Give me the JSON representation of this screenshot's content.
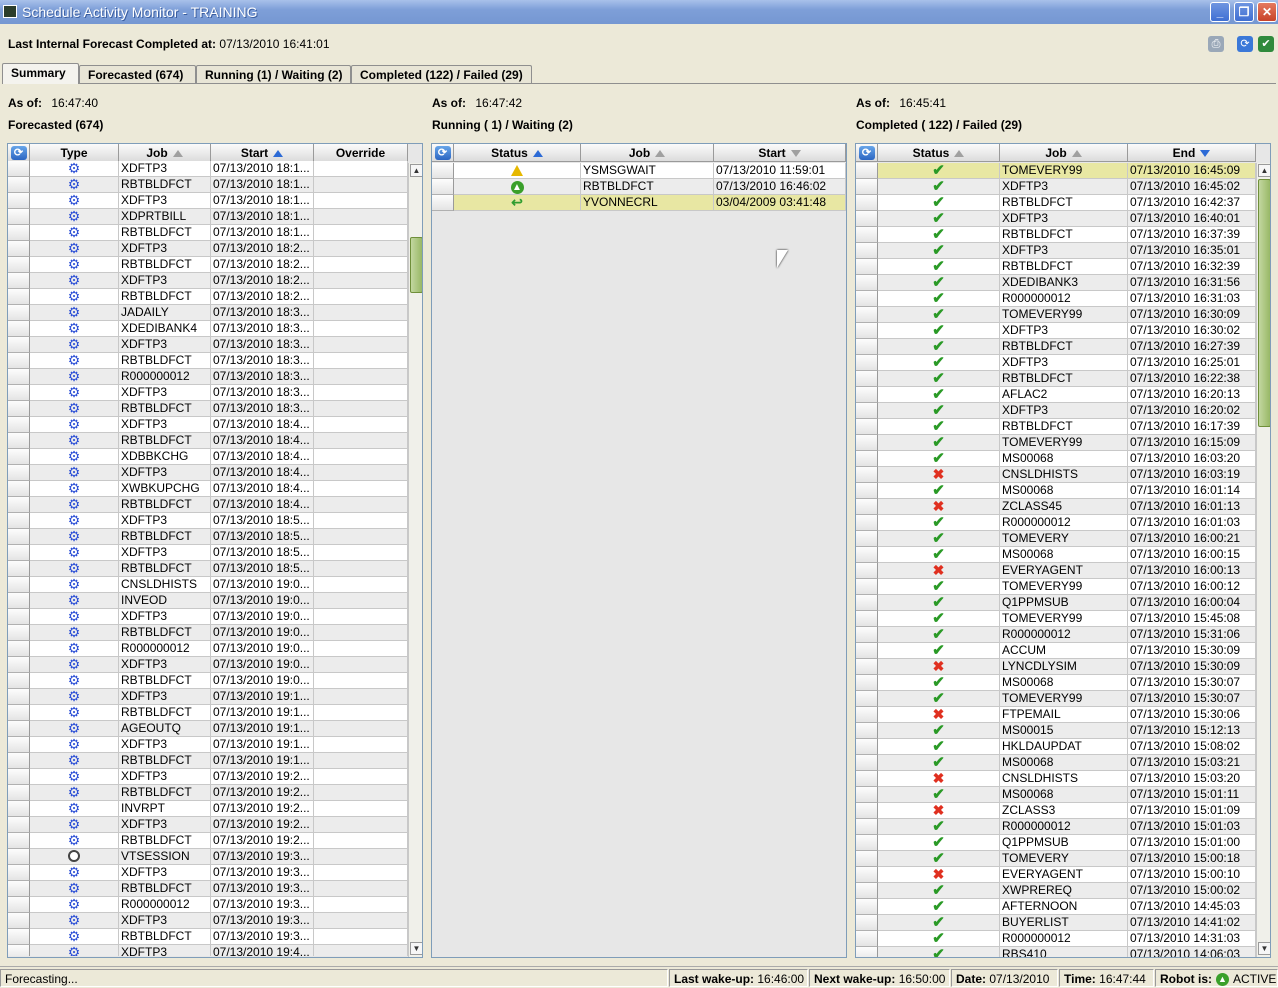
{
  "window": {
    "title": "Schedule Activity Monitor - TRAINING",
    "minimize": "_",
    "restore": "❐",
    "close": "✕"
  },
  "header": {
    "forecast_label": "Last Internal Forecast Completed at:",
    "forecast_value": "07/13/2010 16:41:01"
  },
  "tabs": [
    {
      "label": "Summary",
      "active": true
    },
    {
      "label": "Forecasted (674)",
      "active": false
    },
    {
      "label": "Running (1) / Waiting (2)",
      "active": false
    },
    {
      "label": "Completed (122) / Failed (29)",
      "active": false
    }
  ],
  "forecasted": {
    "as_of_label": "As of:",
    "as_of": "16:47:40",
    "title": "Forecasted (674)",
    "columns": [
      "Type",
      "Job",
      "Start",
      "Override"
    ],
    "rows": [
      [
        "gear",
        "XDFTP3",
        "07/13/2010 18:1..."
      ],
      [
        "gear",
        "RBTBLDFCT",
        "07/13/2010 18:1..."
      ],
      [
        "gear",
        "XDFTP3",
        "07/13/2010 18:1..."
      ],
      [
        "gear",
        "XDPRTBILL",
        "07/13/2010 18:1..."
      ],
      [
        "gear",
        "RBTBLDFCT",
        "07/13/2010 18:1..."
      ],
      [
        "gear",
        "XDFTP3",
        "07/13/2010 18:2..."
      ],
      [
        "gear",
        "RBTBLDFCT",
        "07/13/2010 18:2..."
      ],
      [
        "gear",
        "XDFTP3",
        "07/13/2010 18:2..."
      ],
      [
        "gear",
        "RBTBLDFCT",
        "07/13/2010 18:2..."
      ],
      [
        "gear",
        "JADAILY",
        "07/13/2010 18:3..."
      ],
      [
        "gear",
        "XDEDIBANK4",
        "07/13/2010 18:3..."
      ],
      [
        "gear",
        "XDFTP3",
        "07/13/2010 18:3..."
      ],
      [
        "gear",
        "RBTBLDFCT",
        "07/13/2010 18:3..."
      ],
      [
        "gear",
        "R000000012",
        "07/13/2010 18:3..."
      ],
      [
        "gear",
        "XDFTP3",
        "07/13/2010 18:3..."
      ],
      [
        "gear",
        "RBTBLDFCT",
        "07/13/2010 18:3..."
      ],
      [
        "gear",
        "XDFTP3",
        "07/13/2010 18:4..."
      ],
      [
        "gear",
        "RBTBLDFCT",
        "07/13/2010 18:4..."
      ],
      [
        "gear",
        "XDBBKCHG",
        "07/13/2010 18:4..."
      ],
      [
        "gear",
        "XDFTP3",
        "07/13/2010 18:4..."
      ],
      [
        "gear",
        "XWBKUPCHG",
        "07/13/2010 18:4..."
      ],
      [
        "gear",
        "RBTBLDFCT",
        "07/13/2010 18:4..."
      ],
      [
        "gear",
        "XDFTP3",
        "07/13/2010 18:5..."
      ],
      [
        "gear",
        "RBTBLDFCT",
        "07/13/2010 18:5..."
      ],
      [
        "gear",
        "XDFTP3",
        "07/13/2010 18:5..."
      ],
      [
        "gear",
        "RBTBLDFCT",
        "07/13/2010 18:5..."
      ],
      [
        "gear",
        "CNSLDHISTS",
        "07/13/2010 19:0..."
      ],
      [
        "gear",
        "INVEOD",
        "07/13/2010 19:0..."
      ],
      [
        "gear",
        "XDFTP3",
        "07/13/2010 19:0..."
      ],
      [
        "gear",
        "RBTBLDFCT",
        "07/13/2010 19:0..."
      ],
      [
        "gear",
        "R000000012",
        "07/13/2010 19:0..."
      ],
      [
        "gear",
        "XDFTP3",
        "07/13/2010 19:0..."
      ],
      [
        "gear",
        "RBTBLDFCT",
        "07/13/2010 19:0..."
      ],
      [
        "gear",
        "XDFTP3",
        "07/13/2010 19:1..."
      ],
      [
        "gear",
        "RBTBLDFCT",
        "07/13/2010 19:1..."
      ],
      [
        "gear",
        "AGEOUTQ",
        "07/13/2010 19:1..."
      ],
      [
        "gear",
        "XDFTP3",
        "07/13/2010 19:1..."
      ],
      [
        "gear",
        "RBTBLDFCT",
        "07/13/2010 19:1..."
      ],
      [
        "gear",
        "XDFTP3",
        "07/13/2010 19:2..."
      ],
      [
        "gear",
        "RBTBLDFCT",
        "07/13/2010 19:2..."
      ],
      [
        "gear",
        "INVRPT",
        "07/13/2010 19:2..."
      ],
      [
        "gear",
        "XDFTP3",
        "07/13/2010 19:2..."
      ],
      [
        "gear",
        "RBTBLDFCT",
        "07/13/2010 19:2..."
      ],
      [
        "clock",
        "VTSESSION",
        "07/13/2010 19:3..."
      ],
      [
        "gear",
        "XDFTP3",
        "07/13/2010 19:3..."
      ],
      [
        "gear",
        "RBTBLDFCT",
        "07/13/2010 19:3..."
      ],
      [
        "gear",
        "R000000012",
        "07/13/2010 19:3..."
      ],
      [
        "gear",
        "XDFTP3",
        "07/13/2010 19:3..."
      ],
      [
        "gear",
        "RBTBLDFCT",
        "07/13/2010 19:3..."
      ],
      [
        "gear",
        "XDFTP3",
        "07/13/2010 19:4..."
      ]
    ]
  },
  "running": {
    "as_of_label": "As of:",
    "as_of": "16:47:42",
    "title": "Running ( 1) / Waiting (2)",
    "columns": [
      "Status",
      "Job",
      "Start"
    ],
    "rows": [
      [
        "warning",
        "YSMSGWAIT",
        "07/13/2010 11:59:01"
      ],
      [
        "running",
        "RBTBLDFCT",
        "07/13/2010 16:46:02"
      ],
      [
        "waiting",
        "YVONNECRL",
        "03/04/2009 03:41:48"
      ]
    ]
  },
  "completed": {
    "as_of_label": "As of:",
    "as_of": "16:45:41",
    "title": "Completed ( 122) / Failed (29)",
    "columns": [
      "Status",
      "Job",
      "End"
    ],
    "rows": [
      [
        "ok",
        "TOMEVERY99",
        "07/13/2010 16:45:09"
      ],
      [
        "ok",
        "XDFTP3",
        "07/13/2010 16:45:02"
      ],
      [
        "ok",
        "RBTBLDFCT",
        "07/13/2010 16:42:37"
      ],
      [
        "ok",
        "XDFTP3",
        "07/13/2010 16:40:01"
      ],
      [
        "ok",
        "RBTBLDFCT",
        "07/13/2010 16:37:39"
      ],
      [
        "ok",
        "XDFTP3",
        "07/13/2010 16:35:01"
      ],
      [
        "ok",
        "RBTBLDFCT",
        "07/13/2010 16:32:39"
      ],
      [
        "ok",
        "XDEDIBANK3",
        "07/13/2010 16:31:56"
      ],
      [
        "ok",
        "R000000012",
        "07/13/2010 16:31:03"
      ],
      [
        "ok",
        "TOMEVERY99",
        "07/13/2010 16:30:09"
      ],
      [
        "ok",
        "XDFTP3",
        "07/13/2010 16:30:02"
      ],
      [
        "ok",
        "RBTBLDFCT",
        "07/13/2010 16:27:39"
      ],
      [
        "ok",
        "XDFTP3",
        "07/13/2010 16:25:01"
      ],
      [
        "ok",
        "RBTBLDFCT",
        "07/13/2010 16:22:38"
      ],
      [
        "ok",
        "AFLAC2",
        "07/13/2010 16:20:13"
      ],
      [
        "ok",
        "XDFTP3",
        "07/13/2010 16:20:02"
      ],
      [
        "ok",
        "RBTBLDFCT",
        "07/13/2010 16:17:39"
      ],
      [
        "ok",
        "TOMEVERY99",
        "07/13/2010 16:15:09"
      ],
      [
        "ok",
        "MS00068",
        "07/13/2010 16:03:20"
      ],
      [
        "fail",
        "CNSLDHISTS",
        "07/13/2010 16:03:19"
      ],
      [
        "ok",
        "MS00068",
        "07/13/2010 16:01:14"
      ],
      [
        "fail",
        "ZCLASS45",
        "07/13/2010 16:01:13"
      ],
      [
        "ok",
        "R000000012",
        "07/13/2010 16:01:03"
      ],
      [
        "ok",
        "TOMEVERY",
        "07/13/2010 16:00:21"
      ],
      [
        "ok",
        "MS00068",
        "07/13/2010 16:00:15"
      ],
      [
        "fail",
        "EVERYAGENT",
        "07/13/2010 16:00:13"
      ],
      [
        "ok",
        "TOMEVERY99",
        "07/13/2010 16:00:12"
      ],
      [
        "ok",
        "Q1PPMSUB",
        "07/13/2010 16:00:04"
      ],
      [
        "ok",
        "TOMEVERY99",
        "07/13/2010 15:45:08"
      ],
      [
        "ok",
        "R000000012",
        "07/13/2010 15:31:06"
      ],
      [
        "ok",
        "ACCUM",
        "07/13/2010 15:30:09"
      ],
      [
        "fail",
        "LYNCDLYSIM",
        "07/13/2010 15:30:09"
      ],
      [
        "ok",
        "MS00068",
        "07/13/2010 15:30:07"
      ],
      [
        "ok",
        "TOMEVERY99",
        "07/13/2010 15:30:07"
      ],
      [
        "fail",
        "FTPEMAIL",
        "07/13/2010 15:30:06"
      ],
      [
        "ok",
        "MS00015",
        "07/13/2010 15:12:13"
      ],
      [
        "ok",
        "HKLDAUPDAT",
        "07/13/2010 15:08:02"
      ],
      [
        "ok",
        "MS00068",
        "07/13/2010 15:03:21"
      ],
      [
        "fail",
        "CNSLDHISTS",
        "07/13/2010 15:03:20"
      ],
      [
        "ok",
        "MS00068",
        "07/13/2010 15:01:11"
      ],
      [
        "fail",
        "ZCLASS3",
        "07/13/2010 15:01:09"
      ],
      [
        "ok",
        "R000000012",
        "07/13/2010 15:01:03"
      ],
      [
        "ok",
        "Q1PPMSUB",
        "07/13/2010 15:01:00"
      ],
      [
        "ok",
        "TOMEVERY",
        "07/13/2010 15:00:18"
      ],
      [
        "fail",
        "EVERYAGENT",
        "07/13/2010 15:00:10"
      ],
      [
        "ok",
        "XWPREREQ",
        "07/13/2010 15:00:02"
      ],
      [
        "ok",
        "AFTERNOON",
        "07/13/2010 14:45:03"
      ],
      [
        "ok",
        "BUYERLIST",
        "07/13/2010 14:41:02"
      ],
      [
        "ok",
        "R000000012",
        "07/13/2010 14:31:03"
      ],
      [
        "ok",
        "RBS410",
        "07/13/2010 14:06:03"
      ]
    ]
  },
  "statusbar": {
    "state": "Forecasting...",
    "last_wake_label": "Last wake-up:",
    "last_wake": "16:46:00",
    "next_wake_label": "Next wake-up:",
    "next_wake": "16:50:00",
    "date_label": "Date:",
    "date": "07/13/2010",
    "time_label": "Time:",
    "time": "16:47:44",
    "robot_label": "Robot is:",
    "robot": "ACTIVE"
  },
  "colors": {
    "title_bar": "#7597d2",
    "selected_row": "#e8e7a3",
    "ok": "#2a9a26",
    "fail": "#e03020"
  }
}
